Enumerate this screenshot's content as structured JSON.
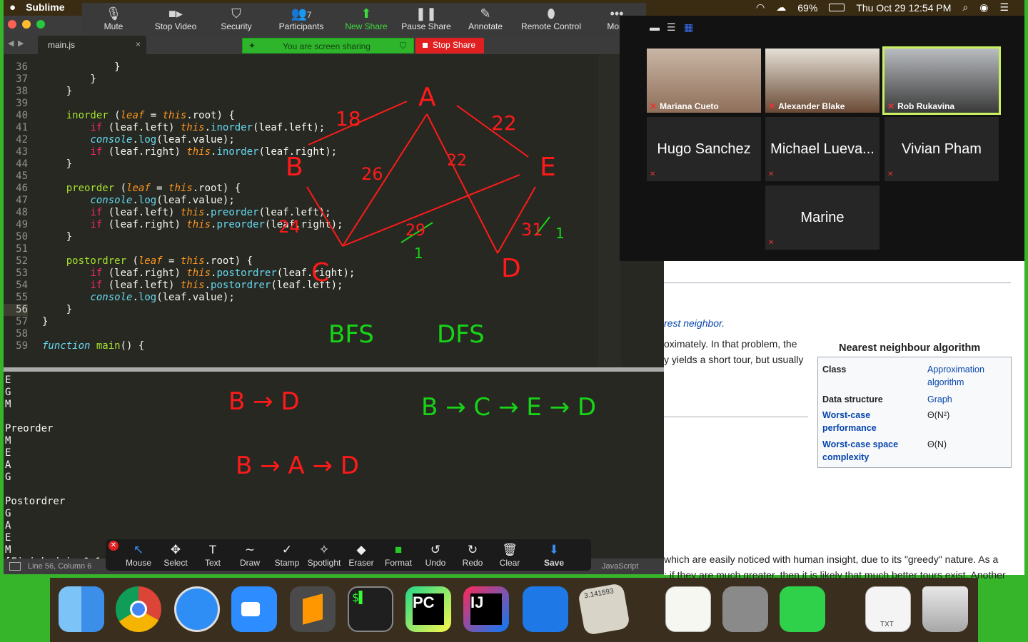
{
  "menubar": {
    "app_name": "Sublime",
    "battery": "69%",
    "datetime": "Thu Oct 29  12:54 PM"
  },
  "zoom_toolbar": {
    "items": [
      "Mute",
      "Stop Video",
      "Security",
      "Participants",
      "New Share",
      "Pause Share",
      "Annotate",
      "Remote Control",
      "More"
    ],
    "participant_count": "7"
  },
  "share_banner": {
    "status": "You are screen sharing",
    "stop_label": "Stop Share"
  },
  "editor": {
    "tab_title": "main.js",
    "status": "Line 56, Column 6",
    "syntax": "JavaScript",
    "lines": [
      {
        "n": "36",
        "text": "            }"
      },
      {
        "n": "37",
        "text": "        }"
      },
      {
        "n": "38",
        "text": "    }"
      },
      {
        "n": "39",
        "text": ""
      },
      {
        "n": "40",
        "text": "    inorder (leaf = this.root) {"
      },
      {
        "n": "41",
        "text": "        if (leaf.left) this.inorder(leaf.left);"
      },
      {
        "n": "42",
        "text": "        console.log(leaf.value);"
      },
      {
        "n": "43",
        "text": "        if (leaf.right) this.inorder(leaf.right);"
      },
      {
        "n": "44",
        "text": "    }"
      },
      {
        "n": "45",
        "text": ""
      },
      {
        "n": "46",
        "text": "    preorder (leaf = this.root) {"
      },
      {
        "n": "47",
        "text": "        console.log(leaf.value);"
      },
      {
        "n": "48",
        "text": "        if (leaf.left) this.preorder(leaf.left);"
      },
      {
        "n": "49",
        "text": "        if (leaf.right) this.preorder(leaf.right);"
      },
      {
        "n": "50",
        "text": "    }"
      },
      {
        "n": "51",
        "text": ""
      },
      {
        "n": "52",
        "text": "    postordrer (leaf = this.root) {"
      },
      {
        "n": "53",
        "text": "        if (leaf.right) this.postordrer(leaf.right);"
      },
      {
        "n": "54",
        "text": "        if (leaf.left) this.postordrer(leaf.left);"
      },
      {
        "n": "55",
        "text": "        console.log(leaf.value);"
      },
      {
        "n": "56",
        "text": "    }"
      },
      {
        "n": "57",
        "text": "}"
      },
      {
        "n": "58",
        "text": ""
      },
      {
        "n": "59",
        "text": "function main() {"
      }
    ],
    "output": [
      "E",
      "G",
      "M",
      "",
      "Preorder",
      "M",
      "E",
      "A",
      "G",
      "",
      "Postordrer",
      "G",
      "A",
      "E",
      "M",
      "[Finished in 0.1s]"
    ]
  },
  "participants": [
    {
      "name": "Mariana Cueto",
      "video": true
    },
    {
      "name": "Alexander Blake",
      "video": true
    },
    {
      "name": "Rob Rukavina",
      "video": true
    },
    {
      "name": "Hugo Sanchez",
      "video": false
    },
    {
      "name": "Michael Lueva...",
      "video": false
    },
    {
      "name": "Vivian Pham",
      "video": false
    },
    {
      "name": "Marine",
      "video": false
    }
  ],
  "browser": {
    "link_fragment": "rest neighbor.",
    "para1": "oximately. In that problem, the",
    "para2": "y yields a short tour, but usually",
    "para3": "which are easily noticed with human insight, due to its \"greedy\" nature. As a",
    "para4": "; if they are much greater, then it is likely that much better tours exist. Another",
    "infobox": {
      "title": "Nearest neighbour algorithm",
      "rows": [
        {
          "label": "Class",
          "value": "Approximation algorithm",
          "label_link": false,
          "value_link": true
        },
        {
          "label": "Data structure",
          "value": "Graph",
          "label_link": false,
          "value_link": true
        },
        {
          "label": "Worst-case performance",
          "value": "Θ(N²)",
          "label_link": true,
          "value_link": false
        },
        {
          "label": "Worst-case space complexity",
          "value": "Θ(N)",
          "label_link": true,
          "value_link": false
        }
      ]
    }
  },
  "annotation_toolbar": {
    "items": [
      "Mouse",
      "Select",
      "Text",
      "Draw",
      "Stamp",
      "Spotlight",
      "Eraser",
      "Format",
      "Undo",
      "Redo",
      "Clear",
      "Save"
    ]
  },
  "dock": {
    "apps": [
      "Finder",
      "Chrome",
      "Safari",
      "Zoom",
      "Sublime Text",
      "Terminal",
      "PyCharm",
      "IntelliJ IDEA",
      "Xcode",
      "Calculator",
      "TextEdit",
      "System Preferences",
      "FaceTime",
      "TXT",
      "Trash"
    ],
    "calc_display": "3.141593",
    "txt_label": "TXT"
  },
  "annotations": {
    "red": [
      "A",
      "B",
      "E",
      "C",
      "D",
      "18",
      "22",
      "26",
      "22",
      "24",
      "29",
      "31",
      "1",
      "1",
      "B → D",
      "B → A → D"
    ],
    "green": [
      "BFS",
      "DFS",
      "B → C → E → D"
    ]
  },
  "colors": {
    "red_ink": "#ff1a1a",
    "green_ink": "#17d417",
    "zoom_green": "#37b52a"
  }
}
